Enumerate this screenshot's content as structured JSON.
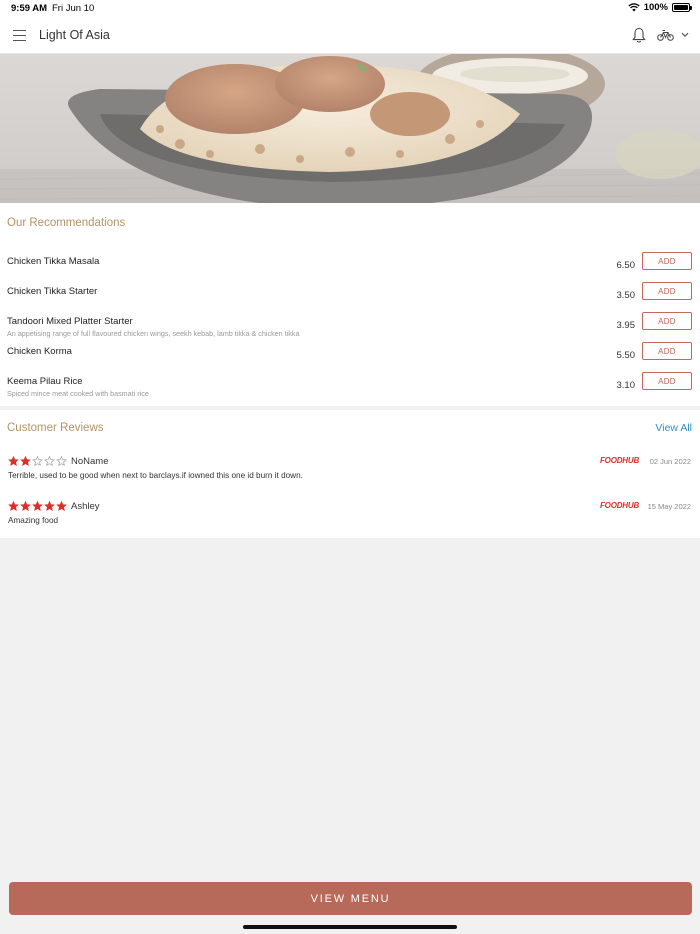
{
  "status_bar": {
    "time": "9:59 AM",
    "date": "Fri Jun 10",
    "battery_percent": "100%"
  },
  "nav": {
    "title": "Light Of Asia",
    "icons": [
      "menu-icon",
      "bell-icon",
      "bike-icon",
      "chevron-down-icon"
    ]
  },
  "recommendations": {
    "title": "Our Recommendations",
    "add_label": "ADD",
    "items": [
      {
        "name": "Chicken Tikka Masala",
        "description": "",
        "price": "6.50"
      },
      {
        "name": "Chicken Tikka Starter",
        "description": "",
        "price": "3.50"
      },
      {
        "name": "Tandoori Mixed Platter Starter",
        "description": "An appetising range of full flavoured chicken wings, seekh kebab, lamb tikka & chicken tikka",
        "price": "3.95"
      },
      {
        "name": "Chicken Korma",
        "description": "",
        "price": "5.50"
      },
      {
        "name": "Keema Pilau Rice",
        "description": "Spiced mince meat cooked with basmati rice",
        "price": "3.10"
      }
    ]
  },
  "reviews": {
    "title": "Customer Reviews",
    "view_all": "View All",
    "items": [
      {
        "rating": 2,
        "max_rating": 5,
        "reviewer": "NoName",
        "source": "FOODHUB",
        "date": "02 Jun 2022",
        "text": "Terrible, used to be good when next to barclays.if iowned this one id burn it down."
      },
      {
        "rating": 5,
        "max_rating": 5,
        "reviewer": "Ashley",
        "source": "FOODHUB",
        "date": "15 May 2022",
        "text": "Amazing food"
      }
    ]
  },
  "footer": {
    "view_menu": "VIEW MENU"
  },
  "colors": {
    "accent": "#b86a5a",
    "section_title": "#b39366",
    "add_border": "#c8665b",
    "star": "#d8322b",
    "link": "#2f8fc4"
  }
}
